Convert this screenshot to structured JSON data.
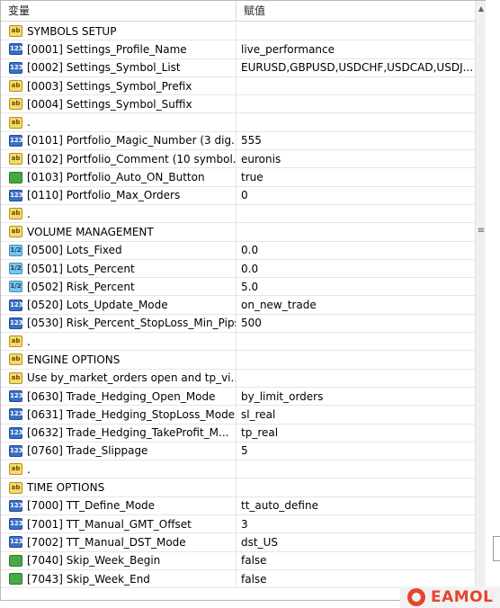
{
  "header": {
    "col_variable": "变量",
    "col_value": "赋值"
  },
  "icon_types": {
    "ab": "ab",
    "int": "123",
    "dbl": "1/2",
    "bool": "bool"
  },
  "rows": [
    {
      "icon": "ab",
      "name": "SYMBOLS SETUP",
      "value": ""
    },
    {
      "icon": "int",
      "name": "[0001] Settings_Profile_Name",
      "value": "live_performance"
    },
    {
      "icon": "int",
      "name": "[0002] Settings_Symbol_List",
      "value": "EURUSD,GBPUSD,USDCHF,USDCAD,USDJ..."
    },
    {
      "icon": "ab",
      "name": "[0003] Settings_Symbol_Prefix",
      "value": ""
    },
    {
      "icon": "ab",
      "name": "[0004] Settings_Symbol_Suffix",
      "value": ""
    },
    {
      "icon": "ab",
      "name": ".",
      "value": ""
    },
    {
      "icon": "int",
      "name": "[0101] Portfolio_Magic_Number (3 dig...",
      "value": "555"
    },
    {
      "icon": "ab",
      "name": "[0102] Portfolio_Comment (10 symbol...",
      "value": "euronis"
    },
    {
      "icon": "bool",
      "name": "[0103] Portfolio_Auto_ON_Button",
      "value": "true"
    },
    {
      "icon": "int",
      "name": "[0110] Portfolio_Max_Orders",
      "value": "0"
    },
    {
      "icon": "ab",
      "name": ".",
      "value": ""
    },
    {
      "icon": "ab",
      "name": "VOLUME MANAGEMENT",
      "value": ""
    },
    {
      "icon": "dbl",
      "name": "[0500] Lots_Fixed",
      "value": "0.0"
    },
    {
      "icon": "dbl",
      "name": "[0501] Lots_Percent",
      "value": "0.0"
    },
    {
      "icon": "dbl",
      "name": "[0502] Risk_Percent",
      "value": "5.0"
    },
    {
      "icon": "int",
      "name": "[0520] Lots_Update_Mode",
      "value": "on_new_trade"
    },
    {
      "icon": "int",
      "name": "[0530] Risk_Percent_StopLoss_Min_Pips",
      "value": "500"
    },
    {
      "icon": "ab",
      "name": ".",
      "value": ""
    },
    {
      "icon": "ab",
      "name": "ENGINE OPTIONS",
      "value": ""
    },
    {
      "icon": "ab",
      "name": "Use by_market_orders open and tp_vi...",
      "value": ""
    },
    {
      "icon": "int",
      "name": "[0630] Trade_Hedging_Open_Mode",
      "value": "by_limit_orders"
    },
    {
      "icon": "int",
      "name": "[0631] Trade_Hedging_StopLoss_Mode",
      "value": "sl_real"
    },
    {
      "icon": "int",
      "name": "[0632] Trade_Hedging_TakeProfit_M...",
      "value": "tp_real"
    },
    {
      "icon": "int",
      "name": "[0760] Trade_Slippage",
      "value": "5"
    },
    {
      "icon": "ab",
      "name": ".",
      "value": ""
    },
    {
      "icon": "ab",
      "name": "TIME OPTIONS",
      "value": ""
    },
    {
      "icon": "int",
      "name": "[7000] TT_Define_Mode",
      "value": "tt_auto_define"
    },
    {
      "icon": "int",
      "name": "[7001] TT_Manual_GMT_Offset",
      "value": "3"
    },
    {
      "icon": "int",
      "name": "[7002] TT_Manual_DST_Mode",
      "value": "dst_US"
    },
    {
      "icon": "bool",
      "name": "[7040] Skip_Week_Begin",
      "value": "false"
    },
    {
      "icon": "bool",
      "name": "[7043] Skip_Week_End",
      "value": "false"
    }
  ],
  "scrollbar": {
    "up_arrow": "▲",
    "grip": "≡"
  },
  "watermark": {
    "brand": "EAMOL"
  }
}
